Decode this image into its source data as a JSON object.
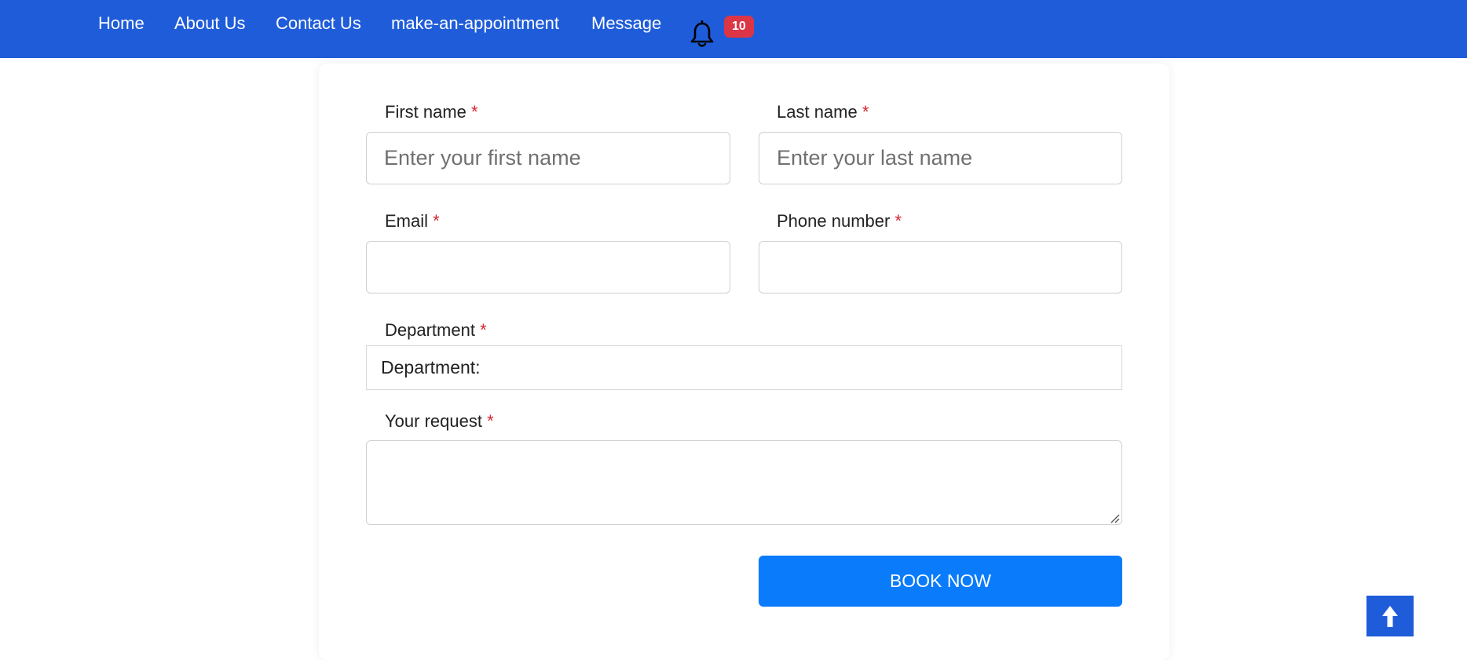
{
  "nav": {
    "links": [
      "Home",
      "About Us",
      "Contact Us",
      "make-an-appointment",
      "Message"
    ],
    "notification_count": "10"
  },
  "form": {
    "first_name": {
      "label": "First name",
      "required_mark": "*",
      "placeholder": "Enter your first name",
      "value": ""
    },
    "last_name": {
      "label": "Last name",
      "required_mark": "*",
      "placeholder": "Enter your last name",
      "value": ""
    },
    "email": {
      "label": "Email",
      "required_mark": "*",
      "value": ""
    },
    "phone": {
      "label": "Phone number",
      "required_mark": "*",
      "value": ""
    },
    "department": {
      "label": "Department",
      "required_mark": "*",
      "selected": "Department:"
    },
    "request": {
      "label": "Your request",
      "required_mark": "*",
      "value": ""
    },
    "submit_label": "BOOK NOW"
  },
  "icons": {
    "notification": "bell-icon",
    "scroll_top": "arrow-up-icon"
  },
  "colors": {
    "navbar": "#1f5cd9",
    "button": "#0a7bfb",
    "badge": "#dc3545",
    "required": "#d9232d"
  }
}
